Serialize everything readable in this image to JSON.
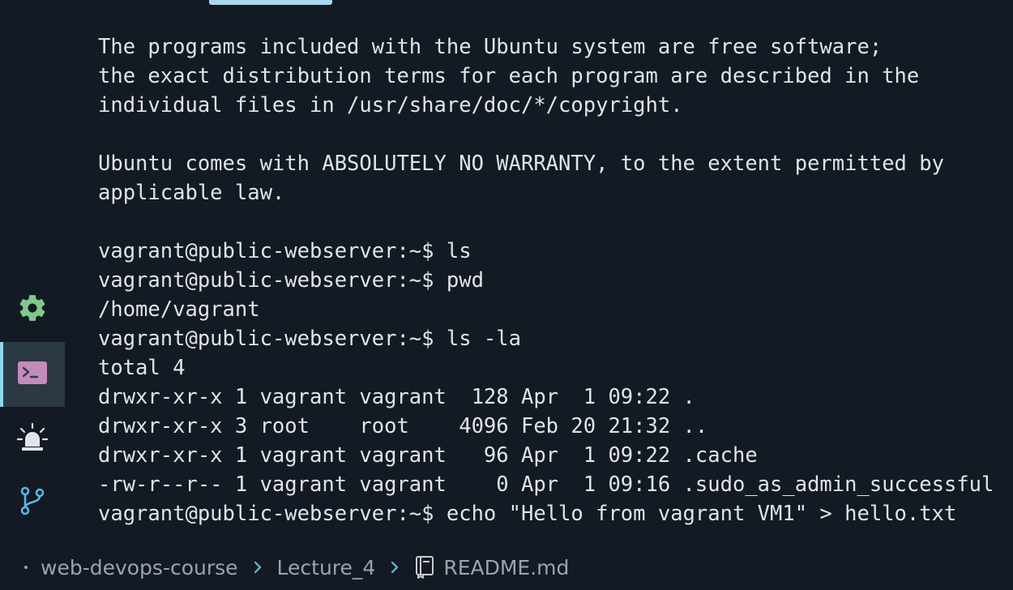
{
  "terminal": {
    "lines": [
      "The programs included with the Ubuntu system are free software;",
      "the exact distribution terms for each program are described in the",
      "individual files in /usr/share/doc/*/copyright.",
      "",
      "Ubuntu comes with ABSOLUTELY NO WARRANTY, to the extent permitted by",
      "applicable law.",
      "",
      "vagrant@public-webserver:~$ ls",
      "vagrant@public-webserver:~$ pwd",
      "/home/vagrant",
      "vagrant@public-webserver:~$ ls -la",
      "total 4",
      "drwxr-xr-x 1 vagrant vagrant  128 Apr  1 09:22 .",
      "drwxr-xr-x 3 root    root    4096 Feb 20 21:32 ..",
      "drwxr-xr-x 1 vagrant vagrant   96 Apr  1 09:22 .cache",
      "-rw-r--r-- 1 vagrant vagrant    0 Apr  1 09:16 .sudo_as_admin_successful",
      "vagrant@public-webserver:~$ echo \"Hello from vagrant VM1\" > hello.txt"
    ]
  },
  "activity_bar": {
    "items": [
      {
        "name": "settings",
        "icon": "gear-icon",
        "active": false
      },
      {
        "name": "terminal",
        "icon": "terminal-icon",
        "active": true
      },
      {
        "name": "alerts",
        "icon": "alarm-light-icon",
        "active": false
      },
      {
        "name": "source-control",
        "icon": "git-branch-icon",
        "active": false
      }
    ]
  },
  "breadcrumb": {
    "items": [
      "web-devops-course",
      "Lecture_4",
      "README.md"
    ]
  },
  "colors": {
    "background": "#141a24",
    "text": "#dfe3ea",
    "accent": "#8ed7ec",
    "settings_icon": "#7fc88a",
    "terminal_icon": "#c38bbd",
    "git_icon": "#58b6e6"
  }
}
